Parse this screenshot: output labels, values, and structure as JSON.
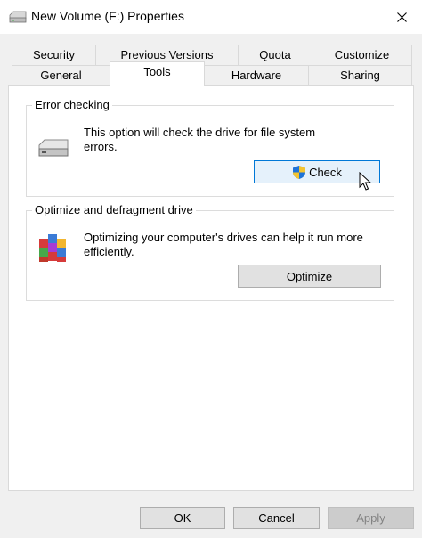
{
  "window": {
    "title": "New Volume (F:) Properties",
    "close_icon": "close-icon",
    "title_icon": "drive-icon"
  },
  "tabs": {
    "row1": [
      "Security",
      "Previous Versions",
      "Quota",
      "Customize"
    ],
    "row2": [
      "General",
      "Tools",
      "Hardware",
      "Sharing"
    ],
    "active": "Tools"
  },
  "error_checking": {
    "label": "Error checking",
    "description_line1": "This option will check the drive for file system",
    "description_line2": "errors.",
    "button": "Check",
    "icon": "drive-icon",
    "button_icon": "uac-shield-icon"
  },
  "optimize": {
    "label": "Optimize and defragment drive",
    "description_line1": "Optimizing your computer's drives can help it run more",
    "description_line2": "efficiently.",
    "button": "Optimize",
    "icon": "defrag-icon"
  },
  "footer": {
    "ok": "OK",
    "cancel": "Cancel",
    "apply": "Apply"
  },
  "colors": {
    "accent": "#0078d7",
    "hover_button": "#e5f1fb",
    "panel_bg": "#ffffff",
    "window_bg": "#f0f0f0"
  }
}
